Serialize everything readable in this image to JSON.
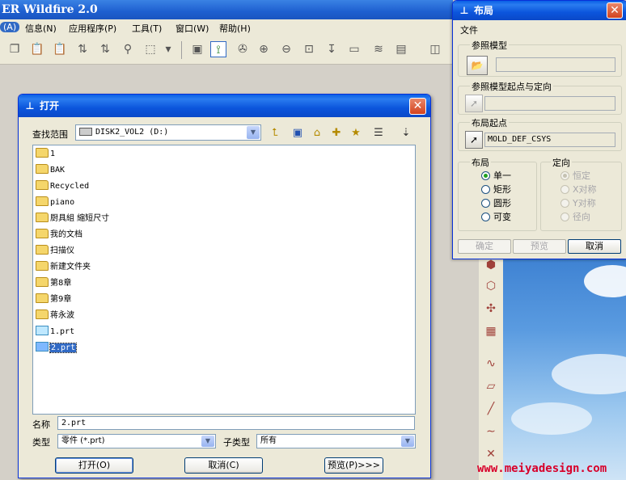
{
  "app": {
    "title": "ER Wildfire 2.0",
    "menu": [
      "(A)",
      "信息(N)",
      "应用程序(P)",
      "工具(T)",
      "窗口(W)",
      "帮助(H)"
    ]
  },
  "icons": {
    "app": "pro-engineer-logo-icon",
    "close": "close-icon",
    "folder": "folder-icon",
    "part": "part-file-icon",
    "select": "select-arrow-icon",
    "open_folder": "open-folder-icon"
  },
  "watermark": "www.meiyadesign.com",
  "open_dialog": {
    "title": "打开",
    "look_in_label": "查找范围",
    "look_in_value": "DISK2_VOL2 (D:)",
    "files": [
      {
        "name": "1",
        "type": "folder"
      },
      {
        "name": "BAK",
        "type": "folder"
      },
      {
        "name": "Recycled",
        "type": "folder"
      },
      {
        "name": "piano",
        "type": "folder"
      },
      {
        "name": "厨具組 縮短尺寸",
        "type": "folder"
      },
      {
        "name": "我的文档",
        "type": "folder"
      },
      {
        "name": "扫描仪",
        "type": "folder"
      },
      {
        "name": "新建文件夹",
        "type": "folder"
      },
      {
        "name": "第8章",
        "type": "folder"
      },
      {
        "name": "第9章",
        "type": "folder"
      },
      {
        "name": "蒋永波",
        "type": "folder"
      },
      {
        "name": "1.prt",
        "type": "part"
      },
      {
        "name": "2.prt",
        "type": "part",
        "selected": true
      }
    ],
    "name_label": "名称",
    "name_value": "2.prt",
    "type_label": "类型",
    "type_value": "零件 (*.prt)",
    "subtype_label": "子类型",
    "subtype_value": "所有",
    "open_button": "打开(O)",
    "cancel_button": "取消(C)",
    "preview_button": "预览(P)>>>"
  },
  "layout_panel": {
    "title": "布局",
    "file_label": "文件",
    "ref_model_label": "参照模型",
    "ref_model_value": "",
    "ref_origin_label": "参照模型起点与定向",
    "ref_origin_value": "",
    "layout_origin_label": "布局起点",
    "layout_origin_value": "MOLD_DEF_CSYS",
    "layout_group_label": "布局",
    "layout_options": [
      {
        "label": "单一",
        "checked": true
      },
      {
        "label": "矩形",
        "checked": false
      },
      {
        "label": "圆形",
        "checked": false
      },
      {
        "label": "可变",
        "checked": false
      }
    ],
    "orient_group_label": "定向",
    "orient_options": [
      {
        "label": "恒定",
        "checked": true
      },
      {
        "label": "X对称",
        "checked": false
      },
      {
        "label": "Y对称",
        "checked": false
      },
      {
        "label": "径向",
        "checked": false
      }
    ],
    "ok_button": "确定",
    "preview_button": "预览",
    "cancel_button": "取消"
  }
}
